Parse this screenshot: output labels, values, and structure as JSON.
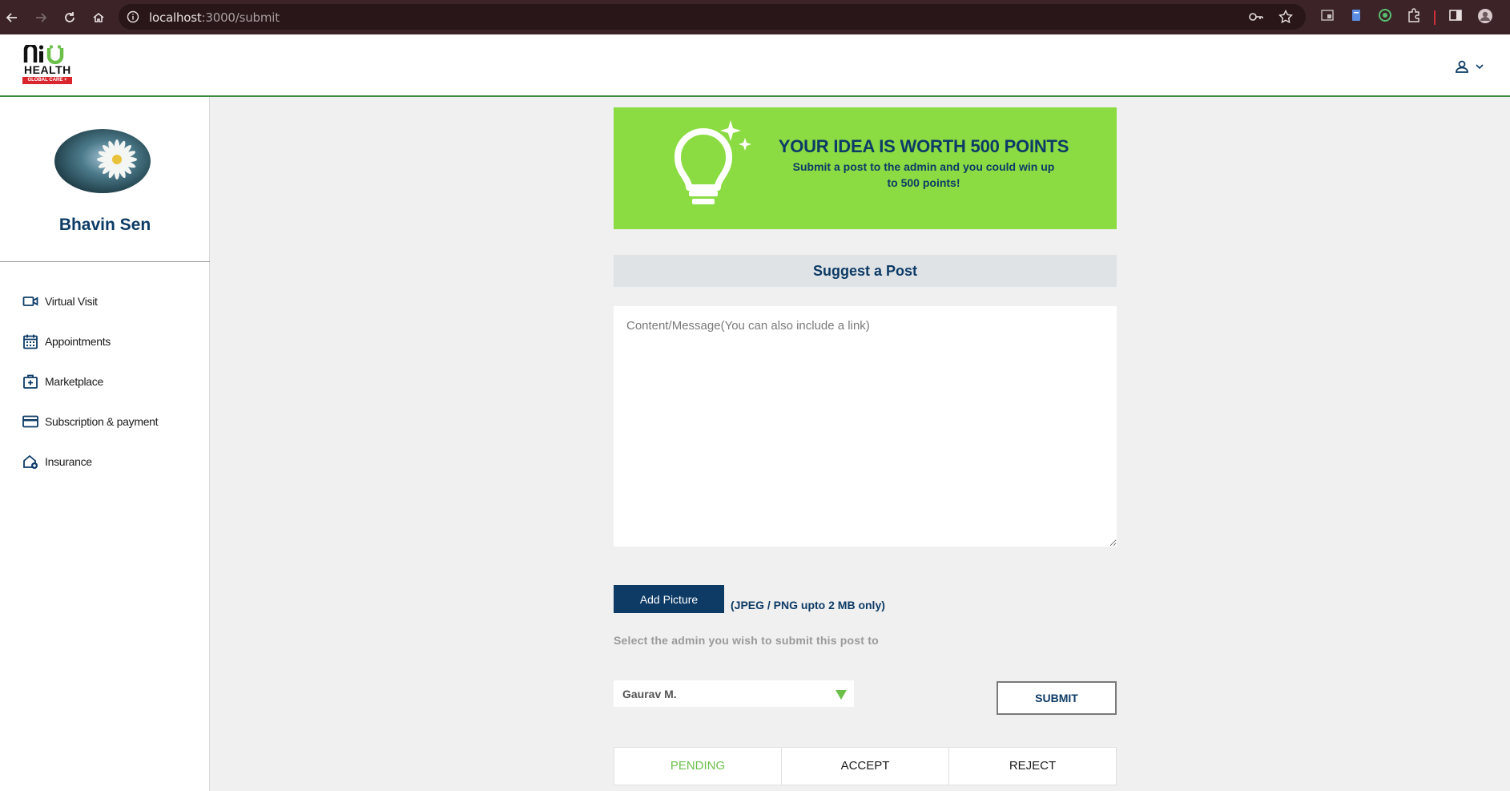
{
  "browser": {
    "url_host": "localhost",
    "url_path": ":3000/submit"
  },
  "app": {
    "logo_text": "HEALTH",
    "logo_tagline": "GLOBAL CARE +"
  },
  "sidebar": {
    "profile_name": "Bhavin Sen",
    "items": [
      {
        "label": "Virtual Visit",
        "icon": "video-camera-icon"
      },
      {
        "label": "Appointments",
        "icon": "calendar-icon"
      },
      {
        "label": "Marketplace",
        "icon": "medical-bag-icon"
      },
      {
        "label": "Subscription & payment",
        "icon": "credit-card-icon"
      },
      {
        "label": "Insurance",
        "icon": "home-shield-icon"
      }
    ]
  },
  "banner": {
    "title": "YOUR IDEA IS WORTH 500 POINTS",
    "subtitle": "Submit a post to the admin and you could win up to 500 points!"
  },
  "form": {
    "heading": "Suggest a Post",
    "message_placeholder": "Content/Message(You can also include a link)",
    "add_picture_label": "Add Picture",
    "picture_note": "(JPEG / PNG upto 2 MB only)",
    "admin_label": "Select the admin you wish to submit this post to",
    "admin_selected": "Gaurav M.",
    "submit_label": "SUBMIT"
  },
  "status_tabs": [
    {
      "label": "PENDING",
      "active": true
    },
    {
      "label": "ACCEPT",
      "active": false
    },
    {
      "label": "REJECT",
      "active": false
    }
  ],
  "colors": {
    "brand_navy": "#0d3b66",
    "banner_green": "#8bdc43",
    "active_tab_green": "#6cc04a"
  }
}
